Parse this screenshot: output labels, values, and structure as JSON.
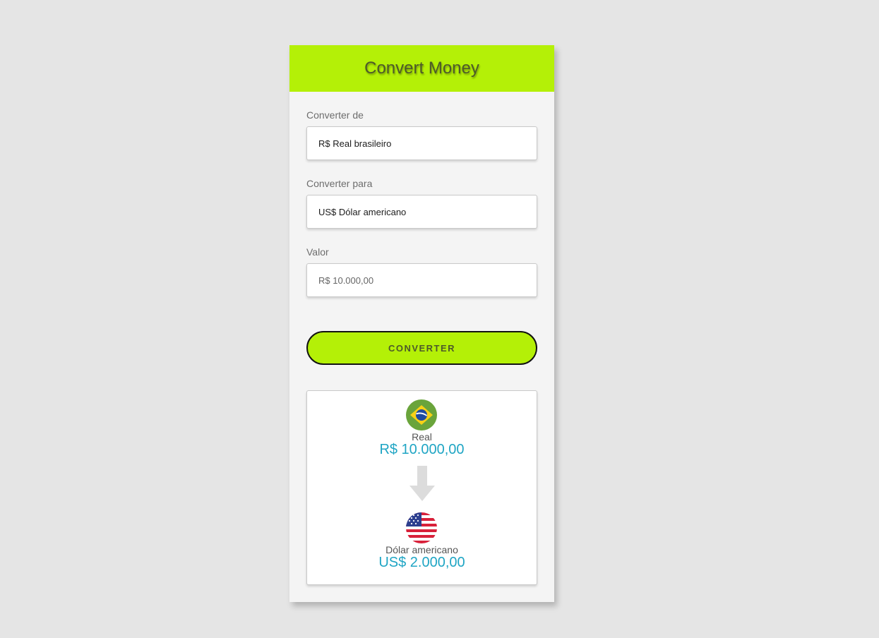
{
  "header": {
    "title": "Convert Money"
  },
  "form": {
    "from_label": "Converter de",
    "from_value": "R$ Real brasileiro",
    "to_label": "Converter para",
    "to_value": "US$ Dólar americano",
    "amount_label": "Valor",
    "amount_placeholder": "R$ 10.000,00"
  },
  "button": {
    "label": "CONVERTER"
  },
  "result": {
    "from": {
      "name": "Real",
      "value": "R$ 10.000,00",
      "icon": "brazil-flag-icon"
    },
    "to": {
      "name": "Dólar americano",
      "value": "US$ 2.000,00",
      "icon": "usa-flag-icon"
    },
    "arrow_icon": "arrow-down-icon"
  },
  "colors": {
    "accent": "#b4f007",
    "value_text": "#1fa5c4",
    "background": "#e5e5e5"
  }
}
